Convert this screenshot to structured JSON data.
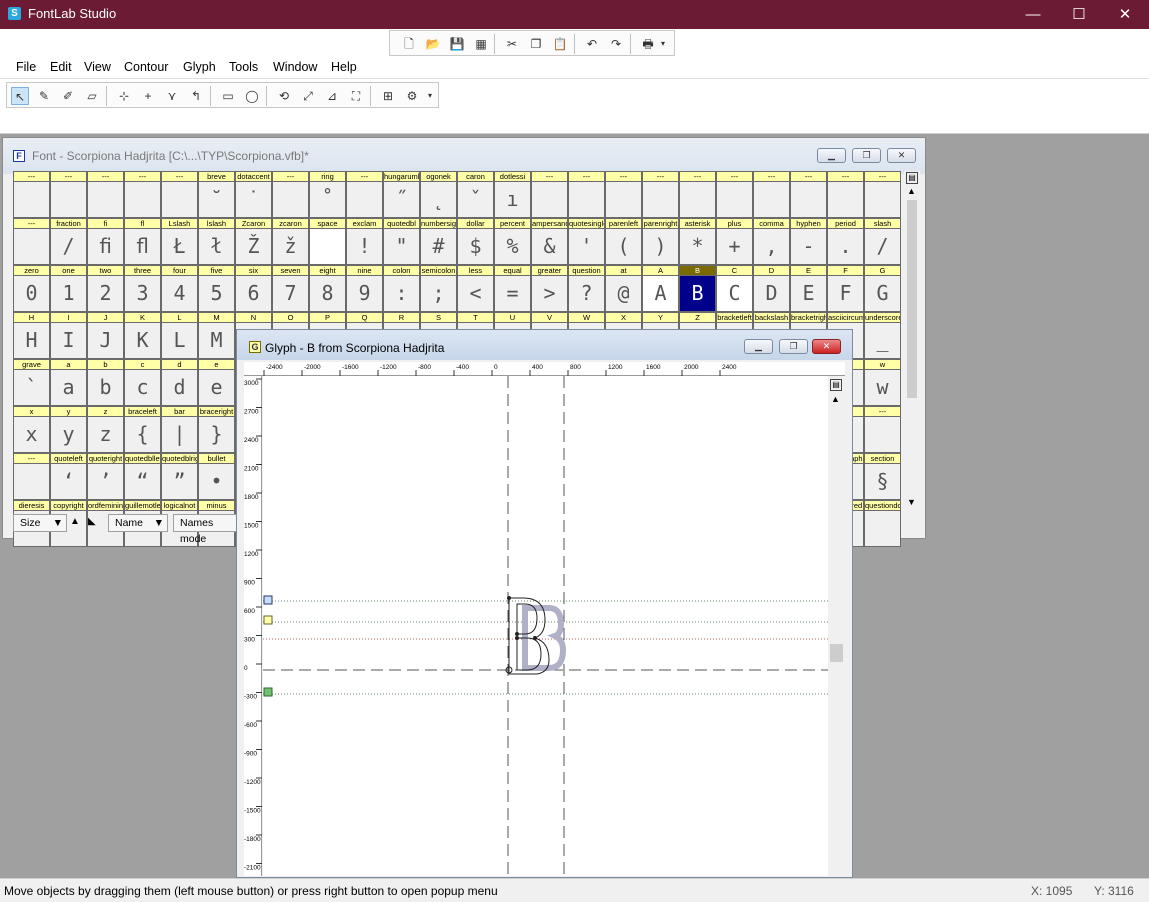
{
  "app": {
    "title": "FontLab Studio",
    "icon": "fontlab-app-icon"
  },
  "window_controls": {
    "minimize": "—",
    "maximize": "☐",
    "close": "✕"
  },
  "menu": [
    "File",
    "Edit",
    "View",
    "Contour",
    "Glyph",
    "Tools",
    "Window",
    "Help"
  ],
  "font_window": {
    "title": "Font - Scorpiona Hadjrita [C:\\...\\TYP\\Scorpiona.vfb]*",
    "icon_letter": "F",
    "rows": [
      [
        {
          "n": "---",
          "g": ""
        },
        {
          "n": "---",
          "g": ""
        },
        {
          "n": "---",
          "g": ""
        },
        {
          "n": "---",
          "g": ""
        },
        {
          "n": "---",
          "g": ""
        },
        {
          "n": "breve",
          "g": "˘"
        },
        {
          "n": "dotaccent",
          "g": "˙"
        },
        {
          "n": "---",
          "g": ""
        },
        {
          "n": "ring",
          "g": "˚"
        },
        {
          "n": "---",
          "g": ""
        },
        {
          "n": "hungarumlaut",
          "g": "˝"
        },
        {
          "n": "ogonek",
          "g": "˛"
        },
        {
          "n": "caron",
          "g": "ˇ"
        },
        {
          "n": "dotlessi",
          "g": "ı"
        },
        {
          "n": "---",
          "g": ""
        },
        {
          "n": "---",
          "g": ""
        },
        {
          "n": "---",
          "g": ""
        },
        {
          "n": "---",
          "g": ""
        },
        {
          "n": "---",
          "g": ""
        },
        {
          "n": "---",
          "g": ""
        },
        {
          "n": "---",
          "g": ""
        },
        {
          "n": "---",
          "g": ""
        },
        {
          "n": "---",
          "g": ""
        },
        {
          "n": "---",
          "g": ""
        }
      ],
      [
        {
          "n": "---",
          "g": ""
        },
        {
          "n": "fraction",
          "g": "/"
        },
        {
          "n": "fi",
          "g": "ﬁ"
        },
        {
          "n": "fl",
          "g": "ﬂ"
        },
        {
          "n": "Lslash",
          "g": "Ł"
        },
        {
          "n": "lslash",
          "g": "ł"
        },
        {
          "n": "Zcaron",
          "g": "Ž"
        },
        {
          "n": "zcaron",
          "g": "ž"
        },
        {
          "n": "space",
          "g": "",
          "w": true
        },
        {
          "n": "exclam",
          "g": "!"
        },
        {
          "n": "quotedbl",
          "g": "\""
        },
        {
          "n": "numbersign",
          "g": "#"
        },
        {
          "n": "dollar",
          "g": "$"
        },
        {
          "n": "percent",
          "g": "%"
        },
        {
          "n": "ampersand",
          "g": "&"
        },
        {
          "n": "quotesingle",
          "g": "'"
        },
        {
          "n": "parenleft",
          "g": "("
        },
        {
          "n": "parenright",
          "g": ")"
        },
        {
          "n": "asterisk",
          "g": "*"
        },
        {
          "n": "plus",
          "g": "+"
        },
        {
          "n": "comma",
          "g": ","
        },
        {
          "n": "hyphen",
          "g": "-"
        },
        {
          "n": "period",
          "g": "."
        },
        {
          "n": "slash",
          "g": "/"
        }
      ],
      [
        {
          "n": "zero",
          "g": "0"
        },
        {
          "n": "one",
          "g": "1"
        },
        {
          "n": "two",
          "g": "2"
        },
        {
          "n": "three",
          "g": "3"
        },
        {
          "n": "four",
          "g": "4"
        },
        {
          "n": "five",
          "g": "5"
        },
        {
          "n": "six",
          "g": "6"
        },
        {
          "n": "seven",
          "g": "7"
        },
        {
          "n": "eight",
          "g": "8"
        },
        {
          "n": "nine",
          "g": "9"
        },
        {
          "n": "colon",
          "g": ":"
        },
        {
          "n": "semicolon",
          "g": ";"
        },
        {
          "n": "less",
          "g": "<"
        },
        {
          "n": "equal",
          "g": "="
        },
        {
          "n": "greater",
          "g": ">"
        },
        {
          "n": "question",
          "g": "?"
        },
        {
          "n": "at",
          "g": "@"
        },
        {
          "n": "A",
          "g": "A",
          "w": true
        },
        {
          "n": "B",
          "g": "B",
          "sel": true
        },
        {
          "n": "C",
          "g": "C",
          "w": true
        },
        {
          "n": "D",
          "g": "D"
        },
        {
          "n": "E",
          "g": "E"
        },
        {
          "n": "F",
          "g": "F"
        },
        {
          "n": "G",
          "g": "G"
        }
      ],
      [
        {
          "n": "H",
          "g": "H"
        },
        {
          "n": "I",
          "g": "I"
        },
        {
          "n": "J",
          "g": "J"
        },
        {
          "n": "K",
          "g": "K"
        },
        {
          "n": "L",
          "g": "L"
        },
        {
          "n": "M",
          "g": "M"
        },
        {
          "n": "N",
          "g": ""
        },
        {
          "n": "O",
          "g": ""
        },
        {
          "n": "P",
          "g": ""
        },
        {
          "n": "Q",
          "g": ""
        },
        {
          "n": "R",
          "g": ""
        },
        {
          "n": "S",
          "g": ""
        },
        {
          "n": "T",
          "g": ""
        },
        {
          "n": "U",
          "g": ""
        },
        {
          "n": "V",
          "g": ""
        },
        {
          "n": "W",
          "g": ""
        },
        {
          "n": "X",
          "g": ""
        },
        {
          "n": "Y",
          "g": ""
        },
        {
          "n": "Z",
          "g": ""
        },
        {
          "n": "bracketleft",
          "g": ""
        },
        {
          "n": "backslash",
          "g": ""
        },
        {
          "n": "bracketright",
          "g": ""
        },
        {
          "n": "asciicircum",
          "g": ""
        },
        {
          "n": "underscore",
          "g": "_"
        }
      ],
      [
        {
          "n": "grave",
          "g": "`"
        },
        {
          "n": "a",
          "g": "a"
        },
        {
          "n": "b",
          "g": "b"
        },
        {
          "n": "c",
          "g": "c"
        },
        {
          "n": "d",
          "g": "d"
        },
        {
          "n": "e",
          "g": "e"
        },
        {
          "n": "",
          "g": ""
        },
        {
          "n": "",
          "g": ""
        },
        {
          "n": "",
          "g": ""
        },
        {
          "n": "",
          "g": ""
        },
        {
          "n": "",
          "g": ""
        },
        {
          "n": "",
          "g": ""
        },
        {
          "n": "",
          "g": ""
        },
        {
          "n": "",
          "g": ""
        },
        {
          "n": "",
          "g": ""
        },
        {
          "n": "",
          "g": ""
        },
        {
          "n": "",
          "g": ""
        },
        {
          "n": "",
          "g": ""
        },
        {
          "n": "",
          "g": ""
        },
        {
          "n": "",
          "g": ""
        },
        {
          "n": "",
          "g": ""
        },
        {
          "n": "",
          "g": ""
        },
        {
          "n": "",
          "g": ""
        },
        {
          "n": "w",
          "g": "w"
        }
      ],
      [
        {
          "n": "x",
          "g": "x"
        },
        {
          "n": "y",
          "g": "y"
        },
        {
          "n": "z",
          "g": "z"
        },
        {
          "n": "braceleft",
          "g": "{"
        },
        {
          "n": "bar",
          "g": "|"
        },
        {
          "n": "braceright",
          "g": "}"
        },
        {
          "n": "",
          "g": ""
        },
        {
          "n": "",
          "g": ""
        },
        {
          "n": "",
          "g": ""
        },
        {
          "n": "",
          "g": ""
        },
        {
          "n": "",
          "g": ""
        },
        {
          "n": "",
          "g": ""
        },
        {
          "n": "",
          "g": ""
        },
        {
          "n": "",
          "g": ""
        },
        {
          "n": "",
          "g": ""
        },
        {
          "n": "",
          "g": ""
        },
        {
          "n": "",
          "g": ""
        },
        {
          "n": "",
          "g": ""
        },
        {
          "n": "",
          "g": ""
        },
        {
          "n": "",
          "g": ""
        },
        {
          "n": "",
          "g": ""
        },
        {
          "n": "",
          "g": ""
        },
        {
          "n": "",
          "g": ""
        },
        {
          "n": "---",
          "g": ""
        }
      ],
      [
        {
          "n": "---",
          "g": ""
        },
        {
          "n": "quoteleft",
          "g": "‘"
        },
        {
          "n": "quoteright",
          "g": "’"
        },
        {
          "n": "quotedblleft",
          "g": "“"
        },
        {
          "n": "quotedblright",
          "g": "”"
        },
        {
          "n": "bullet",
          "g": "•"
        },
        {
          "n": "",
          "g": ""
        },
        {
          "n": "",
          "g": ""
        },
        {
          "n": "",
          "g": ""
        },
        {
          "n": "",
          "g": ""
        },
        {
          "n": "",
          "g": ""
        },
        {
          "n": "",
          "g": ""
        },
        {
          "n": "",
          "g": ""
        },
        {
          "n": "",
          "g": ""
        },
        {
          "n": "",
          "g": ""
        },
        {
          "n": "",
          "g": ""
        },
        {
          "n": "",
          "g": ""
        },
        {
          "n": "",
          "g": ""
        },
        {
          "n": "",
          "g": ""
        },
        {
          "n": "",
          "g": ""
        },
        {
          "n": "",
          "g": ""
        },
        {
          "n": "",
          "g": ""
        },
        {
          "n": "paragraph",
          "g": ""
        },
        {
          "n": "section",
          "g": "§"
        }
      ],
      [
        {
          "n": "dieresis",
          "g": ""
        },
        {
          "n": "copyright",
          "g": ""
        },
        {
          "n": "ordfeminine",
          "g": ""
        },
        {
          "n": "guillemotleft",
          "g": ""
        },
        {
          "n": "logicalnot",
          "g": ""
        },
        {
          "n": "minus",
          "g": ""
        },
        {
          "n": "",
          "g": ""
        },
        {
          "n": "",
          "g": ""
        },
        {
          "n": "",
          "g": ""
        },
        {
          "n": "",
          "g": ""
        },
        {
          "n": "",
          "g": ""
        },
        {
          "n": "",
          "g": ""
        },
        {
          "n": "",
          "g": ""
        },
        {
          "n": "",
          "g": ""
        },
        {
          "n": "",
          "g": ""
        },
        {
          "n": "",
          "g": ""
        },
        {
          "n": "",
          "g": ""
        },
        {
          "n": "",
          "g": ""
        },
        {
          "n": "",
          "g": ""
        },
        {
          "n": "",
          "g": ""
        },
        {
          "n": "",
          "g": ""
        },
        {
          "n": "",
          "g": ""
        },
        {
          "n": "registered",
          "g": ""
        },
        {
          "n": "questiondown",
          "g": ""
        }
      ]
    ],
    "bottom": {
      "size_label": "Size",
      "name_label": "Name",
      "names_mode_label": "Names mode"
    }
  },
  "glyph_window": {
    "title": "Glyph - B from Scorpiona Hadjrita",
    "icon_letter": "G",
    "hruler_ticks": [
      "-2400",
      "-2000",
      "-1600",
      "-1200",
      "-800",
      "-400",
      "0",
      "400",
      "800",
      "1200",
      "1600",
      "2000",
      "2400"
    ],
    "vruler_ticks": [
      "3000",
      "2700",
      "2400",
      "2100",
      "1800",
      "1500",
      "1200",
      "900",
      "600",
      "300",
      "0",
      "-300",
      "-600",
      "-900",
      "-1200",
      "-1500",
      "-1800",
      "-2100"
    ]
  },
  "status": {
    "message": "Move objects by dragging them (left mouse button) or press right button to open popup menu",
    "x": "X: 1095",
    "y": "Y: 3116"
  },
  "colors": {
    "titlebar": "#6b1b34",
    "label_yellow": "#ffffa8",
    "selected_glyph": "#00008b"
  }
}
